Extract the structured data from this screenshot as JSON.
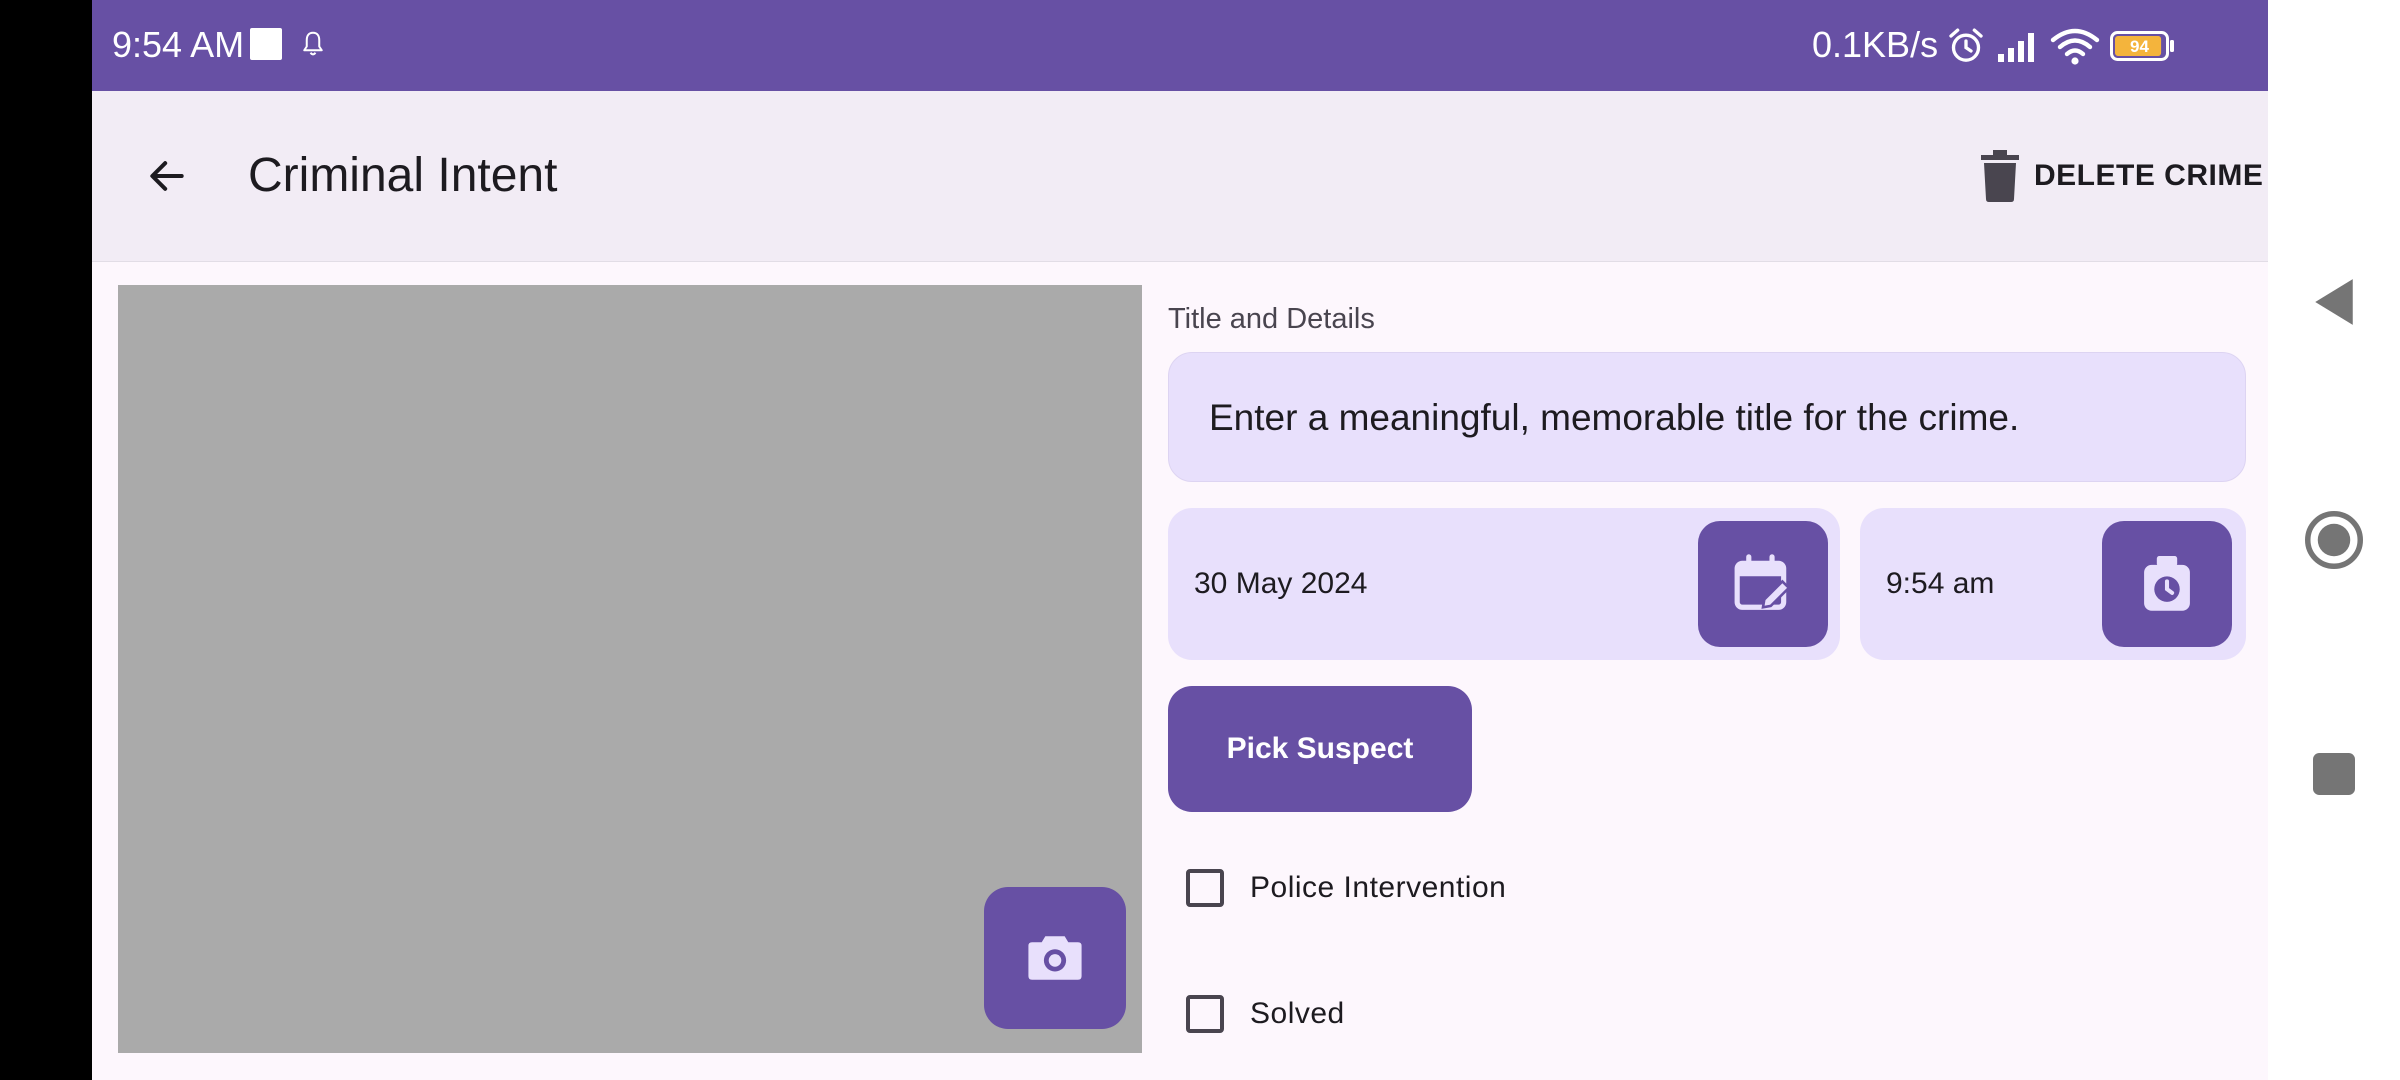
{
  "status_bar": {
    "time": "9:54 AM",
    "network_speed": "0.1KB/s",
    "battery_level": "94",
    "icons": [
      "notification-square-icon",
      "bell-icon",
      "alarm-icon",
      "signal-icon",
      "wifi-icon",
      "battery-icon"
    ]
  },
  "app_bar": {
    "title": "Criminal Intent",
    "delete_label": "DELETE CRIME",
    "icons": [
      "arrow-back-icon",
      "trash-icon"
    ]
  },
  "photo": {
    "icons": [
      "camera-icon"
    ]
  },
  "form": {
    "section_label": "Title and Details",
    "title_placeholder": "Enter a meaningful, memorable title for the crime.",
    "title_value": "",
    "date": "30 May 2024",
    "time": "9:54 am",
    "pick_suspect_label": "Pick Suspect",
    "checkboxes": [
      {
        "label": "Police Intervention",
        "checked": false
      },
      {
        "label": "Solved",
        "checked": false
      }
    ],
    "icons": [
      "calendar-edit-icon",
      "clock-icon"
    ]
  },
  "nav_bar": {
    "icons": [
      "nav-back-icon",
      "nav-home-icon",
      "nav-recents-icon"
    ]
  },
  "colors": {
    "primary": "#6750a4",
    "status_bar": "#6750a4",
    "app_bar_background": "#f2ecf5",
    "field_background": "#e8e0fc",
    "photo_placeholder": "#aaaaaa",
    "screen_background": "#fdf7fd",
    "battery_fill": "#f4b43c"
  }
}
